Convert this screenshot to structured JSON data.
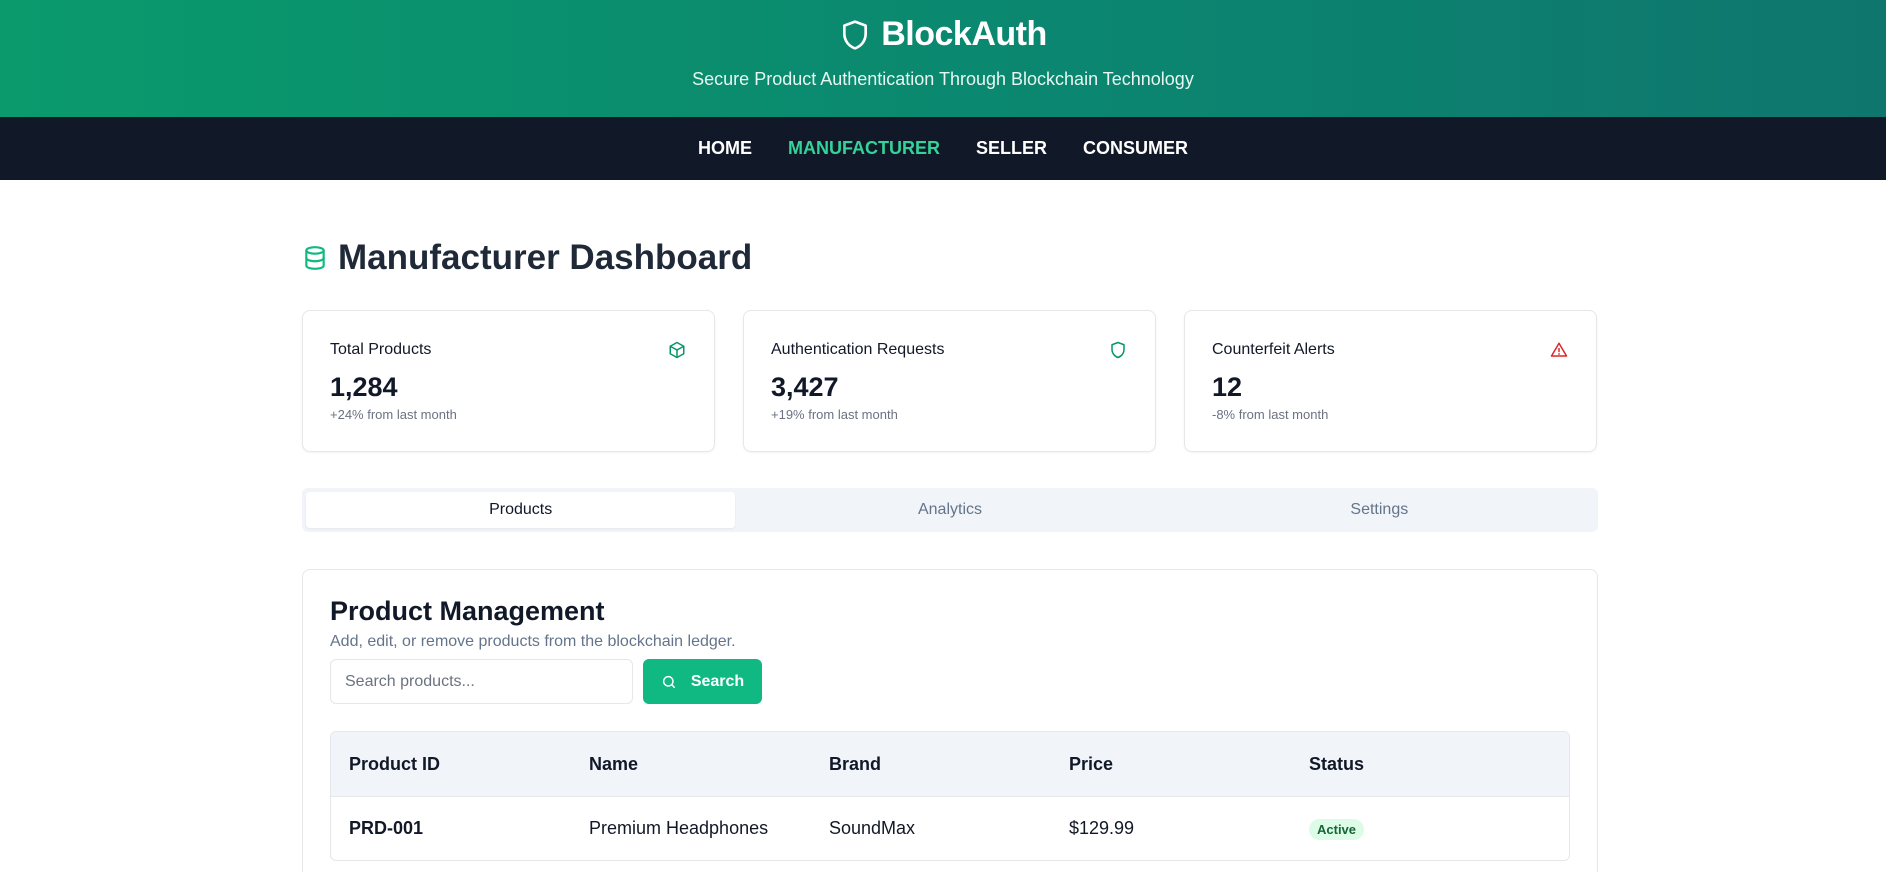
{
  "header": {
    "brand": "BlockAuth",
    "tagline": "Secure Product Authentication Through Blockchain Technology"
  },
  "nav": {
    "items": [
      {
        "label": "HOME"
      },
      {
        "label": "MANUFACTURER"
      },
      {
        "label": "SELLER"
      },
      {
        "label": "CONSUMER"
      }
    ],
    "active": "MANUFACTURER"
  },
  "page": {
    "title": "Manufacturer Dashboard"
  },
  "stats": [
    {
      "label": "Total Products",
      "value": "1,284",
      "sub": "+24% from last month",
      "icon": "box-icon"
    },
    {
      "label": "Authentication Requests",
      "value": "3,427",
      "sub": "+19% from last month",
      "icon": "shield-icon"
    },
    {
      "label": "Counterfeit Alerts",
      "value": "12",
      "sub": "-8% from last month",
      "icon": "alert-triangle-icon"
    }
  ],
  "tabs": [
    {
      "label": "Products"
    },
    {
      "label": "Analytics"
    },
    {
      "label": "Settings"
    }
  ],
  "product_management": {
    "title": "Product Management",
    "description": "Add, edit, or remove products from the blockchain ledger.",
    "search_placeholder": "Search products...",
    "search_button": "Search",
    "columns": [
      "Product ID",
      "Name",
      "Brand",
      "Price",
      "Status"
    ],
    "rows": [
      {
        "id": "PRD-001",
        "name": "Premium Headphones",
        "brand": "SoundMax",
        "price": "$129.99",
        "status": "Active"
      }
    ]
  },
  "colors": {
    "accent": "#10b981",
    "nav_active": "#34d399",
    "nav_bg": "#111827",
    "alert": "#dc2626"
  }
}
